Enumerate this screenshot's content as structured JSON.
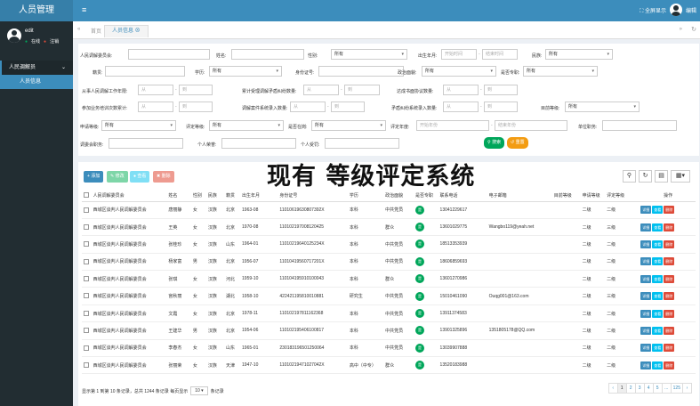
{
  "header": {
    "brand": "人员管理",
    "fullscreen": "全屏显示",
    "user": "编辑",
    "menu_icon": "≡"
  },
  "sidebar": {
    "username": "edit",
    "status_online": "在线",
    "status_logout": "注销",
    "group_label": "人民调解员",
    "item_label": "人员信息"
  },
  "tabs": {
    "home": "首页",
    "active": "人员信息"
  },
  "filter": {
    "l_committee": "人民调解委员会:",
    "l_name": "姓名:",
    "l_gender": "性别:",
    "gender_val": "所有",
    "l_birth": "出生年月:",
    "birth_start_ph": "开始时间",
    "birth_end_ph": "结束时间",
    "l_ethnic": "民族:",
    "ethnic_val": "所有",
    "l_origin": "籍贯:",
    "l_edu": "学历:",
    "edu_val": "所有",
    "l_idcard": "身份证号:",
    "l_party": "政治面貌:",
    "party_val": "所有",
    "l_pro": "是否专职:",
    "pro_val": "所有",
    "l_years": "从事人民调解工作年限:",
    "l_cases": "累计受理调解矛盾纠纷数量:",
    "l_success": "达成书面协议数量:",
    "l_train": "参加业务培训次数累计:",
    "l_sys": "调解案件系统录入数量:",
    "l_paper": "矛盾纠纷系统录入数量:",
    "l_level": "目前等级:",
    "level_val": "所有",
    "l_apply": "申请等级:",
    "apply_val": "所有",
    "l_eval": "评定等级:",
    "eval_val": "所有",
    "l_term": "是否在岗:",
    "term_val": "所有",
    "l_evalyear": "评定年度:",
    "evalyear_start_ph": "开始年份",
    "evalyear_end_ph": "结束年份",
    "l_unit": "单位职务:",
    "l_duty": "调委会职务:",
    "l_honor": "个人荣誉:",
    "l_punish": "个人受罚:",
    "range_from": "从",
    "range_to": "到",
    "btn_search": "搜索",
    "btn_reset": "重置"
  },
  "overlay_title": "现有 等级评定系统",
  "toolbar": {
    "add": "添加",
    "edit": "修改",
    "view": "查看",
    "del": "删除"
  },
  "table": {
    "headers": [
      "人民调解委员会",
      "姓名",
      "性别",
      "民族",
      "籍贯",
      "出生年月",
      "身份证号",
      "学历",
      "政治面貌",
      "是否专职",
      "联系电话",
      "电子邮箱",
      "目前等级",
      "申请等级",
      "评定等级",
      "操作"
    ],
    "action_labels": [
      "详细",
      "查看",
      "删除"
    ],
    "rows": [
      [
        "西城区谈判人民调解委员会",
        "唐丽静",
        "女",
        "汉族",
        "北京",
        "1963-08",
        "11010619630807392X",
        "本科",
        "中共党员",
        "是",
        "13041229617",
        "",
        "",
        "二级",
        "二级"
      ],
      [
        "西城区谈判人民调解委员会",
        "王英",
        "女",
        "汉族",
        "北京",
        "1970-08",
        "110102197008120425",
        "本科",
        "群众",
        "是",
        "13601029775",
        "Wangbo119@yeah.net",
        "",
        "二级",
        "三级"
      ],
      [
        "西城区谈判人民调解委员会",
        "张桂珍",
        "女",
        "汉族",
        "山东",
        "1964-01",
        "11010219640125234X",
        "本科",
        "中共党员",
        "是",
        "18513353939",
        "",
        "",
        "二级",
        "二级"
      ],
      [
        "西城区谈判人民调解委员会",
        "杨家富",
        "男",
        "汉族",
        "北京",
        "1956-07",
        "11010419560717201X",
        "本科",
        "中共党员",
        "是",
        "18606859693",
        "",
        "",
        "二级",
        "二级"
      ],
      [
        "西城区谈判人民调解委员会",
        "张琪",
        "女",
        "汉族",
        "河北",
        "1959-10",
        "110104195910100043",
        "本科",
        "群众",
        "是",
        "13601270986",
        "",
        "",
        "二级",
        "二级"
      ],
      [
        "西城区谈判人民调解委员会",
        "宫秋丽",
        "女",
        "汉族",
        "湖北",
        "1958-10",
        "422421195810010881",
        "研究生",
        "中共党员",
        "是",
        "15010461090",
        "Ouqg001@163.com",
        "",
        "二级",
        "三级"
      ],
      [
        "西城区谈判人民调解委员会",
        "文霞",
        "女",
        "汉族",
        "北京",
        "1978-11",
        "110102197811162368",
        "本科",
        "中共党员",
        "是",
        "13911374583",
        "",
        "",
        "二级",
        "二级"
      ],
      [
        "西城区谈判人民调解委员会",
        "王建华",
        "男",
        "汉族",
        "北京",
        "1954-06",
        "110102195406100817",
        "本科",
        "中共党员",
        "是",
        "13901325896",
        "1351805178@QQ.com",
        "",
        "二级",
        "二级"
      ],
      [
        "西城区谈判人民调解委员会",
        "李春杰",
        "女",
        "汉族",
        "山东",
        "1965-01",
        "230183196501250064",
        "本科",
        "中共党员",
        "是",
        "13039907888",
        "",
        "",
        "二级",
        "二级"
      ],
      [
        "西城区谈判人民调解委员会",
        "张丽荣",
        "女",
        "汉族",
        "天津",
        "1947-10",
        "11010219471027042X",
        "高中（中专）",
        "群众",
        "是",
        "13520183988",
        "",
        "",
        "二级",
        "二级"
      ]
    ]
  },
  "pager": {
    "info_prefix": "显示第 1 到第 10 条记录，总共 1244 条记录 每页显示",
    "per_page": "10",
    "info_suffix": "条记录",
    "pages": [
      "‹",
      "1",
      "2",
      "3",
      "4",
      "5",
      "...",
      "125",
      "›"
    ]
  },
  "colors": {
    "header": "#3c8dbc",
    "sidebar": "#222d32",
    "success": "#00a65a",
    "warning": "#f39c12",
    "danger": "#dd4b39",
    "info": "#00c0ef"
  }
}
